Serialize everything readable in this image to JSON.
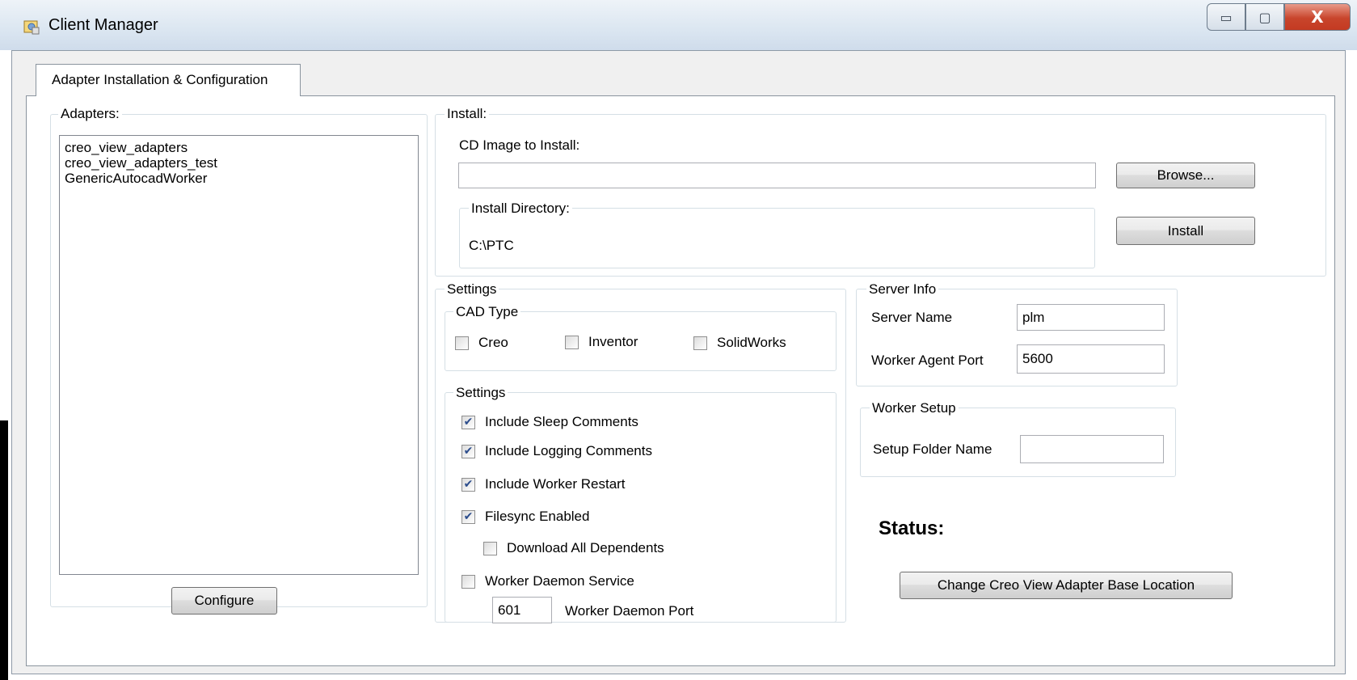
{
  "window": {
    "title": "Client Manager",
    "minimize": "▭",
    "maximize": "▢",
    "close": "X"
  },
  "tabs": [
    {
      "label": "Adapter Installation & Configuration"
    }
  ],
  "adapters": {
    "label": "Adapters:",
    "items": [
      "creo_view_adapters",
      "creo_view_adapters_test",
      "GenericAutocadWorker"
    ],
    "configure_label": "Configure"
  },
  "install": {
    "label": "Install:",
    "cd_image_label": "CD Image to Install:",
    "cd_image_value": "",
    "browse_label": "Browse...",
    "install_dir_label": "Install Directory:",
    "install_dir_value": "C:\\PTC",
    "install_label": "Install"
  },
  "settings": {
    "label": "Settings",
    "cad_type": {
      "label": "CAD Type",
      "options": [
        {
          "label": "Creo",
          "checked": false
        },
        {
          "label": "Inventor",
          "checked": false
        },
        {
          "label": "SolidWorks",
          "checked": false
        }
      ]
    },
    "inner_label": "Settings",
    "options": [
      {
        "label": "Include Sleep Comments",
        "checked": true
      },
      {
        "label": "Include Logging Comments",
        "checked": true
      },
      {
        "label": "Include Worker Restart",
        "checked": true
      },
      {
        "label": "Filesync Enabled",
        "checked": true
      },
      {
        "label": "Download All Dependents",
        "checked": false
      },
      {
        "label": "Worker Daemon Service",
        "checked": false
      }
    ],
    "daemon_port_value": "601",
    "daemon_port_label": "Worker Daemon Port"
  },
  "server_info": {
    "label": "Server Info",
    "server_name_label": "Server Name",
    "server_name_value": "plm",
    "agent_port_label": "Worker Agent Port",
    "agent_port_value": "5600"
  },
  "worker_setup": {
    "label": "Worker Setup",
    "folder_label": "Setup Folder Name",
    "folder_value": ""
  },
  "status": {
    "label": "Status:"
  },
  "change_location_label": "Change Creo View Adapter Base Location",
  "colors": {
    "check": "#2b4c8c",
    "close_button": "#c8452c"
  }
}
